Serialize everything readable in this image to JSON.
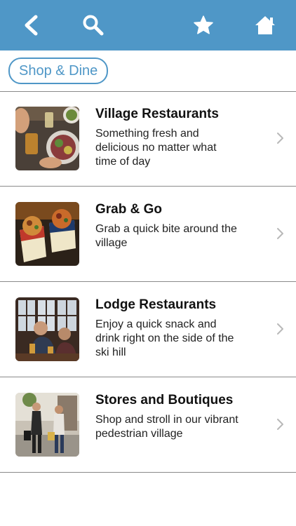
{
  "header": {
    "icons": [
      "back-icon",
      "search-icon",
      "star-icon",
      "home-icon"
    ],
    "background_color": "#4f97c7"
  },
  "filter": {
    "chip_label": "Shop & Dine"
  },
  "list": {
    "items": [
      {
        "title": "Village Restaurants",
        "description": "Something fresh and delicious no matter what time of day",
        "image": "restaurant-food-photo"
      },
      {
        "title": "Grab & Go",
        "description": "Grab a quick bite around the village",
        "image": "takeout-food-photo"
      },
      {
        "title": "Lodge Restaurants",
        "description": "Enjoy a quick snack and drink right on the side of the ski hill",
        "image": "lodge-diners-photo"
      },
      {
        "title": "Stores and Boutiques",
        "description": "Shop and stroll in our vibrant pedestrian village",
        "image": "shoppers-photo"
      }
    ]
  }
}
